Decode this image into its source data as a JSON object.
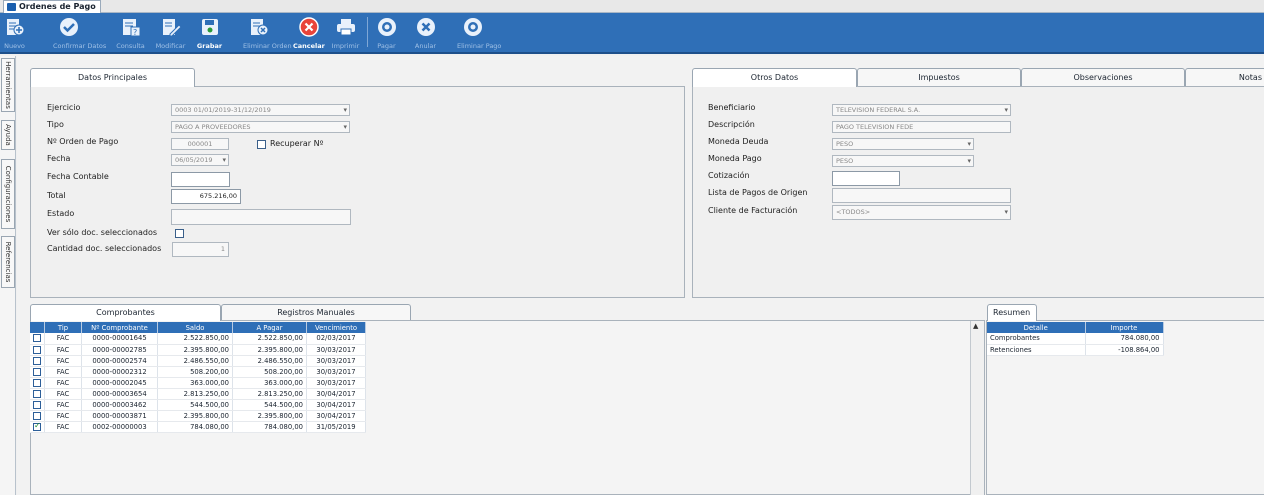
{
  "window": {
    "tab_title": "Ordenes de Pago"
  },
  "toolbar": {
    "nuevo": "Nuevo",
    "confirmar": "Confirmar Datos",
    "consulta": "Consulta",
    "modificar": "Modificar",
    "grabar": "Grabar",
    "eliminar_orden": "Eliminar Orden",
    "cancelar": "Cancelar",
    "imprimir": "Imprimir",
    "pagar": "Pagar",
    "anular": "Anular",
    "eliminar_pago": "Eliminar Pago"
  },
  "sidebar": [
    "Herramientas",
    "Ayuda",
    "Configuraciones",
    "Referencias"
  ],
  "datos_principales": {
    "tab": "Datos Principales",
    "labels": {
      "ejercicio": "Ejercicio",
      "tipo": "Tipo",
      "nro_orden": "Nº Orden de Pago",
      "fecha": "Fecha",
      "fecha_contable": "Fecha Contable",
      "total": "Total",
      "estado": "Estado",
      "ver_solo": "Ver sólo doc. seleccionados",
      "cantidad": "Cantidad doc. seleccionados",
      "recuperar": "Recuperar Nº"
    },
    "values": {
      "ejercicio": "0003 01/01/2019-31/12/2019",
      "tipo": "PAGO A PROVEEDORES",
      "nro_orden": "000001",
      "fecha": "06/05/2019",
      "fecha_contable": "",
      "total": "675.216,00",
      "estado": "",
      "cantidad": "1"
    }
  },
  "otros": {
    "tabs": [
      "Otros Datos",
      "Impuestos",
      "Observaciones",
      "Notas"
    ],
    "labels": {
      "beneficiario": "Beneficiario",
      "descripcion": "Descripción",
      "moneda_deuda": "Moneda Deuda",
      "moneda_pago": "Moneda Pago",
      "cotizacion": "Cotización",
      "lista_pagos": "Lista de Pagos de Origen",
      "cliente": "Cliente de Facturación"
    },
    "values": {
      "beneficiario": "TELEVISION FEDERAL S.A.",
      "descripcion": "PAGO TELEVISION FEDE",
      "moneda_deuda": "PESO",
      "moneda_pago": "PESO",
      "cotizacion": "",
      "lista_pagos": "",
      "cliente": "<TODOS>"
    }
  },
  "comprobantes": {
    "tabs": [
      "Comprobantes",
      "Registros Manuales"
    ],
    "headers": [
      "Tip",
      "Nº Comprobante",
      "Saldo",
      "A Pagar",
      "Vencimiento"
    ],
    "rows": [
      {
        "checked": false,
        "tip": "FAC",
        "nro": "0000-00001645",
        "saldo": "2.522.850,00",
        "apagar": "2.522.850,00",
        "venc": "02/03/2017"
      },
      {
        "checked": false,
        "tip": "FAC",
        "nro": "0000-00002785",
        "saldo": "2.395.800,00",
        "apagar": "2.395.800,00",
        "venc": "30/03/2017"
      },
      {
        "checked": false,
        "tip": "FAC",
        "nro": "0000-00002574",
        "saldo": "2.486.550,00",
        "apagar": "2.486.550,00",
        "venc": "30/03/2017"
      },
      {
        "checked": false,
        "tip": "FAC",
        "nro": "0000-00002312",
        "saldo": "508.200,00",
        "apagar": "508.200,00",
        "venc": "30/03/2017"
      },
      {
        "checked": false,
        "tip": "FAC",
        "nro": "0000-00002045",
        "saldo": "363.000,00",
        "apagar": "363.000,00",
        "venc": "30/03/2017"
      },
      {
        "checked": false,
        "tip": "FAC",
        "nro": "0000-00003654",
        "saldo": "2.813.250,00",
        "apagar": "2.813.250,00",
        "venc": "30/04/2017"
      },
      {
        "checked": false,
        "tip": "FAC",
        "nro": "0000-00003462",
        "saldo": "544.500,00",
        "apagar": "544.500,00",
        "venc": "30/04/2017"
      },
      {
        "checked": false,
        "tip": "FAC",
        "nro": "0000-00003871",
        "saldo": "2.395.800,00",
        "apagar": "2.395.800,00",
        "venc": "30/04/2017"
      },
      {
        "checked": true,
        "tip": "FAC",
        "nro": "0002-00000003",
        "saldo": "784.080,00",
        "apagar": "784.080,00",
        "venc": "31/05/2019"
      }
    ]
  },
  "resumen": {
    "tab": "Resumen",
    "headers": [
      "Detalle",
      "Importe"
    ],
    "rows": [
      {
        "detalle": "Comprobantes",
        "importe": "784.080,00"
      },
      {
        "detalle": "Retenciones",
        "importe": "-108.864,00"
      }
    ]
  }
}
